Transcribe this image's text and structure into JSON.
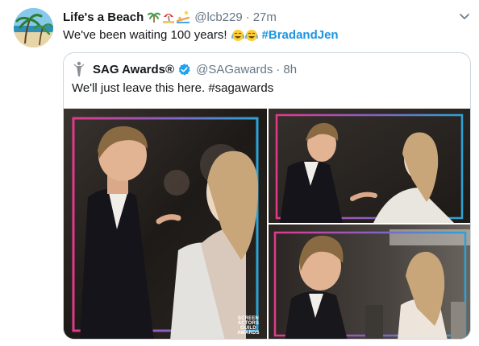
{
  "tweet": {
    "display_name": "Life's a Beach",
    "name_emojis": [
      "palm-tree-emoji",
      "beach-umbrella-emoji",
      "person-sunbathing-emoji"
    ],
    "handle": "@lcb229",
    "separator": "·",
    "time": "27m",
    "text": "We've been waiting 100 years!",
    "text_emojis": [
      "face-with-tears-of-joy-emoji",
      "face-with-tears-of-joy-emoji"
    ],
    "hashtag": "#BradandJen"
  },
  "quoted": {
    "display_name": "SAG Awards®",
    "handle": "@SAGawards",
    "separator": "·",
    "time": "8h",
    "text": "We'll just leave this here.",
    "hashtag": "#sagawards",
    "photo_watermark": [
      "SCREEN",
      "ACTORS",
      "GUILD",
      "AWARDS"
    ]
  },
  "colors": {
    "link": "#1b95e0",
    "secondary_text": "#657786",
    "verified": "#1da1f2",
    "border": "#ccd6dd",
    "frame_gradient": [
      "#e03a8c",
      "#8a5fc4",
      "#2aa3d8"
    ]
  },
  "icons": {
    "caret": "chevron-down-icon",
    "verified": "verified-badge-icon",
    "quoted_logo": "sag-actor-statue-logo"
  }
}
